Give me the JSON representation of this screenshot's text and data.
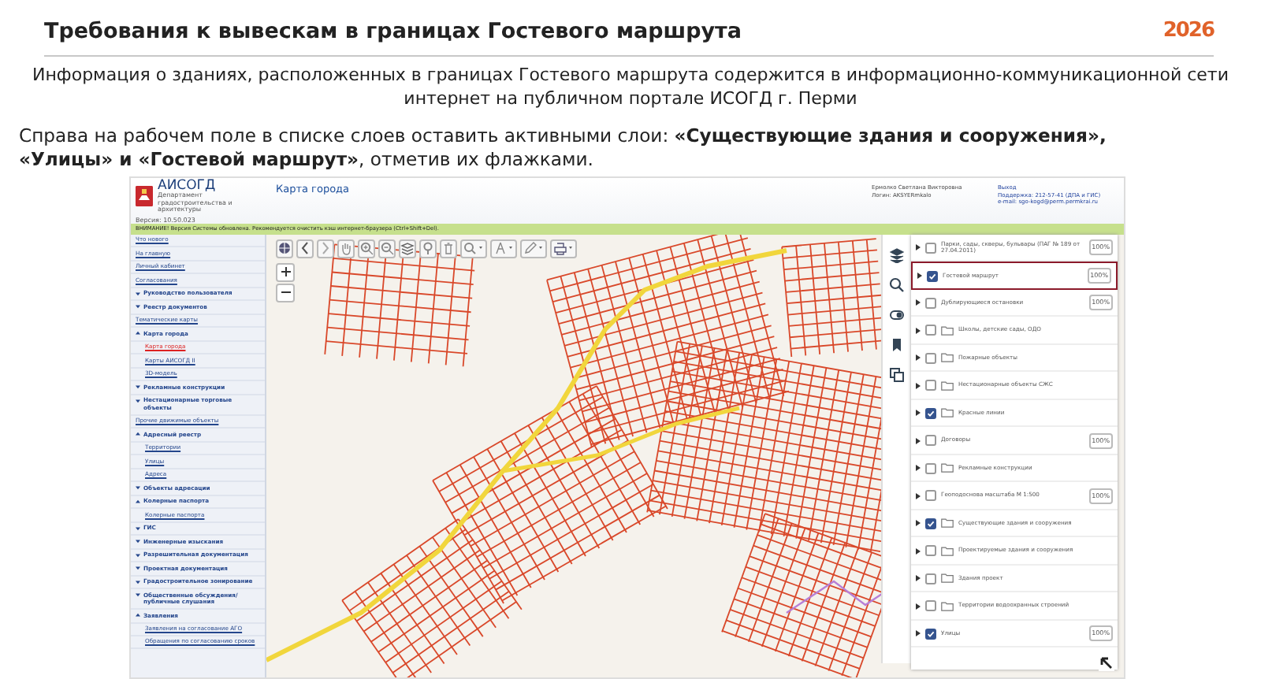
{
  "slide": {
    "title": "Требования к вывескам в границах Гостевого маршрута",
    "logo": "2026"
  },
  "info_text": "Информация о зданиях, расположенных в границах Гостевого маршрута содержится в информационно-коммуникационной сети интернет на публичном портале ИСОГД г. Перми",
  "instruction_text": "Справа на рабочем поле в списке слоев оставить активными слои: **«Существующие здания и сооружения», «Улицы» и «Гостевой маршрут»**, отметив их флажками.",
  "app": {
    "logo_title": "АИСОГД",
    "logo_subtitle": "Департамент градостроительства и архитектуры",
    "version": "Версия: 10.50.023",
    "page_title": "Карта города",
    "user": {
      "name": "Ермолко Светлана Викторовна",
      "login": "Логин: AKSYERmkalo"
    },
    "support": {
      "exit": "Выход",
      "phone": "Поддержка: 212-57-41 (ДПА и ГИС)",
      "email": "e-mail: sgo-kogd@perm.permkrai.ru"
    },
    "notice": "ВНИМАНИЕ! Версия Системы обновлена. Рекомендуется очистить кэш интернет-браузера (Ctrl+Shift+Del).",
    "sidebar": [
      {
        "label": "Что нового",
        "kind": "link",
        "selected": false
      },
      {
        "label": "На главную",
        "kind": "link",
        "selected": false
      },
      {
        "label": "Личный кабинет",
        "kind": "link",
        "selected": false
      },
      {
        "label": "Согласования",
        "kind": "link",
        "selected": false
      },
      {
        "label": "Руководство пользователя",
        "kind": "group",
        "expanded": false,
        "selected": false
      },
      {
        "label": "Реестр документов",
        "kind": "group",
        "expanded": false,
        "selected": false
      },
      {
        "label": "Тематические карты",
        "kind": "link",
        "selected": false
      },
      {
        "label": "Карта города",
        "kind": "group",
        "expanded": true,
        "selected": false,
        "children": [
          {
            "label": "Карта города",
            "kind": "child",
            "selected": true
          },
          {
            "label": "Карты АИСОГД II",
            "kind": "child",
            "selected": false
          },
          {
            "label": "3D-модель",
            "kind": "child",
            "selected": false
          }
        ]
      },
      {
        "label": "Рекламные конструкции",
        "kind": "group",
        "expanded": false,
        "selected": false
      },
      {
        "label": "Нестационарные торговые объекты",
        "kind": "group",
        "expanded": false,
        "selected": false
      },
      {
        "label": "Прочие движимые объекты",
        "kind": "link",
        "selected": false
      },
      {
        "label": "Адресный реестр",
        "kind": "group",
        "expanded": true,
        "selected": false,
        "children": [
          {
            "label": "Территории",
            "kind": "child",
            "selected": false
          },
          {
            "label": "Улицы",
            "kind": "child",
            "selected": false
          },
          {
            "label": "Адреса",
            "kind": "child",
            "selected": false
          }
        ]
      },
      {
        "label": "Объекты адресации",
        "kind": "group",
        "expanded": false,
        "selected": false
      },
      {
        "label": "Колерные паспорта",
        "kind": "group",
        "expanded": true,
        "selected": false,
        "children": [
          {
            "label": "Колерные паспорта",
            "kind": "child",
            "selected": false
          }
        ]
      },
      {
        "label": "ГИС",
        "kind": "group",
        "expanded": false,
        "selected": false
      },
      {
        "label": "Инженерные изыскания",
        "kind": "group",
        "expanded": false,
        "selected": false
      },
      {
        "label": "Разрешительная документация",
        "kind": "group",
        "expanded": false,
        "selected": false
      },
      {
        "label": "Проектная документация",
        "kind": "group",
        "expanded": false,
        "selected": false
      },
      {
        "label": "Градостроительное зонирование",
        "kind": "group",
        "expanded": false,
        "selected": false
      },
      {
        "label": "Общественные обсуждения/ публичные слушания",
        "kind": "group",
        "expanded": false,
        "selected": false
      },
      {
        "label": "Заявления",
        "kind": "group",
        "expanded": true,
        "selected": false,
        "children": [
          {
            "label": "Заявления на согласование АГО",
            "kind": "child",
            "selected": false
          },
          {
            "label": "Обращения по согласованию сроков",
            "kind": "child",
            "selected": false
          }
        ]
      }
    ],
    "layers": [
      {
        "label": "Парки, сады, скверы, бульвары (ПАГ № 189 от 27.04.2011)",
        "checked": false,
        "folder": false,
        "opacity": "100%",
        "highlighted": false
      },
      {
        "label": "Гостевой маршрут",
        "checked": true,
        "folder": false,
        "opacity": "100%",
        "highlighted": true
      },
      {
        "label": "Дублирующиеся остановки",
        "checked": false,
        "folder": false,
        "opacity": "100%",
        "highlighted": false
      },
      {
        "label": "Школы, детские сады, ОДО",
        "checked": false,
        "folder": true,
        "highlighted": false
      },
      {
        "label": "Пожарные объекты",
        "checked": false,
        "folder": true,
        "highlighted": false
      },
      {
        "label": "Нестационарные объекты СЖС",
        "checked": false,
        "folder": true,
        "highlighted": false
      },
      {
        "label": "Красные линии",
        "checked": true,
        "folder": true,
        "highlighted": false
      },
      {
        "label": "Договоры",
        "checked": false,
        "folder": false,
        "opacity": "100%",
        "highlighted": false
      },
      {
        "label": "Рекламные конструкции",
        "checked": false,
        "folder": true,
        "highlighted": false
      },
      {
        "label": "Геоподоснова масштаба М 1:500",
        "checked": false,
        "folder": false,
        "opacity": "100%",
        "highlighted": false
      },
      {
        "label": "Существующие здания и сооружения",
        "checked": true,
        "folder": true,
        "highlighted": false
      },
      {
        "label": "Проектируемые здания и сооружения",
        "checked": false,
        "folder": true,
        "highlighted": false
      },
      {
        "label": "Здания проект",
        "checked": false,
        "folder": true,
        "highlighted": false
      },
      {
        "label": "Территории водоохранных строений",
        "checked": false,
        "folder": true,
        "highlighted": false
      },
      {
        "label": "Улицы",
        "checked": true,
        "folder": false,
        "opacity": "100%",
        "highlighted": false
      }
    ]
  }
}
